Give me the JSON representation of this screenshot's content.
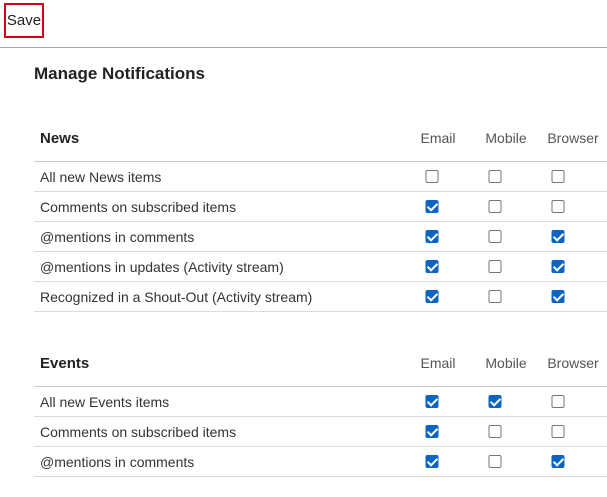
{
  "toolbar": {
    "save_label": "Save"
  },
  "page": {
    "title": "Manage Notifications"
  },
  "sections": [
    {
      "title": "News",
      "columns": [
        "Email",
        "Mobile",
        "Browser"
      ],
      "rows": [
        {
          "label": "All new News items",
          "values": [
            false,
            false,
            false
          ]
        },
        {
          "label": "Comments on subscribed items",
          "values": [
            true,
            false,
            false
          ]
        },
        {
          "label": "@mentions in comments",
          "values": [
            true,
            false,
            true
          ]
        },
        {
          "label": "@mentions in updates (Activity stream)",
          "values": [
            true,
            false,
            true
          ]
        },
        {
          "label": "Recognized in a Shout-Out (Activity stream)",
          "values": [
            true,
            false,
            true
          ]
        }
      ]
    },
    {
      "title": "Events",
      "columns": [
        "Email",
        "Mobile",
        "Browser"
      ],
      "rows": [
        {
          "label": "All new Events items",
          "values": [
            true,
            true,
            false
          ]
        },
        {
          "label": "Comments on subscribed items",
          "values": [
            true,
            false,
            false
          ]
        },
        {
          "label": "@mentions in comments",
          "values": [
            true,
            false,
            true
          ]
        }
      ]
    }
  ],
  "colors": {
    "checkbox_checked": "#0a64c2",
    "save_highlight": "#d0021b"
  }
}
